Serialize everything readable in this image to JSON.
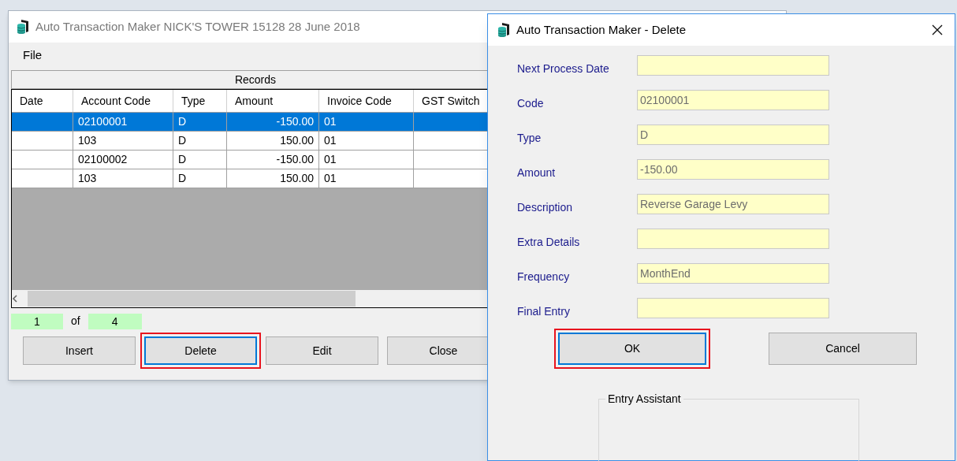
{
  "main_window": {
    "title": "Auto Transaction Maker NICK'S TOWER 15128 28 June 2018",
    "menu": [
      "File"
    ],
    "records": {
      "title": "Records",
      "columns": [
        "Date",
        "Account Code",
        "Type",
        "Amount",
        "Invoice Code",
        "GST Switch"
      ],
      "rows": [
        {
          "account_code": "02100001",
          "type": "D",
          "amount": "-150.00",
          "invoice_code": "01",
          "selected": true
        },
        {
          "account_code": "103",
          "type": "D",
          "amount": "150.00",
          "invoice_code": "01",
          "selected": false
        },
        {
          "account_code": "02100002",
          "type": "D",
          "amount": "-150.00",
          "invoice_code": "01",
          "selected": false
        },
        {
          "account_code": "103",
          "type": "D",
          "amount": "150.00",
          "invoice_code": "01",
          "selected": false
        }
      ]
    },
    "pager": {
      "current": "1",
      "of_label": "of",
      "total": "4"
    },
    "buttons": [
      {
        "label": "Insert",
        "focused": false,
        "highlighted": false
      },
      {
        "label": "Delete",
        "focused": true,
        "highlighted": true
      },
      {
        "label": "Edit",
        "focused": false,
        "highlighted": false
      },
      {
        "label": "Close",
        "focused": false,
        "highlighted": false
      }
    ]
  },
  "dialog": {
    "title": "Auto Transaction Maker - Delete",
    "fields": [
      {
        "label": "Next Process Date"
      },
      {
        "label": "Code",
        "value": "02100001"
      },
      {
        "label": "Type",
        "value": "D"
      },
      {
        "label": "Amount",
        "value": "-150.00"
      },
      {
        "label": "Description",
        "value": "Reverse Garage Levy"
      },
      {
        "label": "Extra Details"
      },
      {
        "label": "Frequency",
        "value": "MonthEnd"
      },
      {
        "label": "Final Entry"
      }
    ],
    "buttons": [
      {
        "label": "OK",
        "focused": true,
        "highlighted": true
      },
      {
        "label": "Cancel",
        "focused": false,
        "highlighted": false
      }
    ],
    "group_title": "Entry Assistant"
  }
}
